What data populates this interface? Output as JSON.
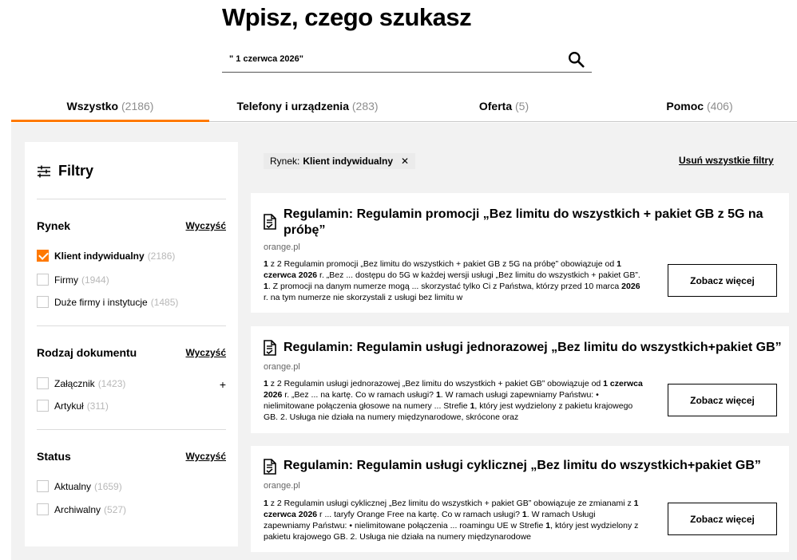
{
  "page": {
    "title": "Wpisz, czego szukasz"
  },
  "search": {
    "value": "\" 1 czerwca 2026\""
  },
  "tabs": [
    {
      "label": "Wszystko",
      "count": "(2186)"
    },
    {
      "label": "Telefony i urządzenia",
      "count": "(283)"
    },
    {
      "label": "Oferta",
      "count": "(5)"
    },
    {
      "label": "Pomoc",
      "count": "(406)"
    }
  ],
  "filters": {
    "title": "Filtry",
    "sections": [
      {
        "title": "Rynek",
        "clear_label": "Wyczyść",
        "options": [
          {
            "label": "Klient indywidualny",
            "count": "(2186)",
            "checked": true
          },
          {
            "label": "Firmy",
            "count": "(1944)",
            "checked": false
          },
          {
            "label": "Duże firmy i instytucje",
            "count": "(1485)",
            "checked": false
          }
        ]
      },
      {
        "title": "Rodzaj dokumentu",
        "clear_label": "Wyczyść",
        "expand_symbol": "+",
        "options": [
          {
            "label": "Załącznik",
            "count": "(1423)",
            "checked": false
          },
          {
            "label": "Artykuł",
            "count": "(311)",
            "checked": false
          }
        ]
      },
      {
        "title": "Status",
        "clear_label": "Wyczyść",
        "options": [
          {
            "label": "Aktualny",
            "count": "(1659)",
            "checked": false
          },
          {
            "label": "Archiwalny",
            "count": "(527)",
            "checked": false
          }
        ]
      }
    ]
  },
  "active_filter": {
    "prefix": "Rynek:",
    "value": "Klient indywidualny"
  },
  "remove_all_label": "Usuń wszystkie filtry",
  "results": [
    {
      "title_line1": "Regulamin: Regulamin promocji „Bez limitu do wszystkich + pakiet GB z 5G na",
      "title_line2": "próbę”",
      "source": "orange.pl",
      "snippet": [
        {
          "b": "1"
        },
        {
          "t": " z 2 Regulamin promocji „Bez limitu do wszystkich + pakiet GB z 5G na próbę” obowiązuje od "
        },
        {
          "b": "1 czerwca 2026"
        },
        {
          "t": " r. „Bez ... dostępu do 5G w każdej wersji usługi „Bez limitu do wszystkich + pakiet GB”. "
        },
        {
          "b": "1"
        },
        {
          "t": ". Z promocji na danym numerze mogą ... skorzystać tylko Ci z Państwa, którzy przed 10 marca "
        },
        {
          "b": "2026"
        },
        {
          "t": " r. na tym numerze nie skorzystali z usługi bez limitu w"
        }
      ],
      "button": "Zobacz więcej"
    },
    {
      "title_line1": "Regulamin: Regulamin usługi jednorazowej „Bez limitu do wszystkich+pakiet GB”",
      "title_line2": "",
      "source": "orange.pl",
      "snippet": [
        {
          "b": "1"
        },
        {
          "t": " z 2 Regulamin usługi jednorazowej „Bez limitu do wszystkich + pakiet GB” obowiązuje od "
        },
        {
          "b": "1 czerwca 2026"
        },
        {
          "t": " r. „Bez ... na kartę. Co w ramach usługi? "
        },
        {
          "b": "1"
        },
        {
          "t": ". W ramach usługi zapewniamy Państwu: • nielimitowane połączenia głosowe na numery ... Strefie "
        },
        {
          "b": "1"
        },
        {
          "t": ", który jest wydzielony z pakietu krajowego GB. 2. Usługa nie działa na numery międzynarodowe, skrócone oraz"
        }
      ],
      "button": "Zobacz więcej"
    },
    {
      "title_line1": "Regulamin: Regulamin usługi cyklicznej „Bez limitu do wszystkich+pakiet GB”",
      "title_line2": "",
      "source": "orange.pl",
      "snippet": [
        {
          "b": "1"
        },
        {
          "t": " z 2 Regulamin usługi cyklicznej „Bez limitu do wszystkich + pakiet GB” obowiązuje ze zmianami z "
        },
        {
          "b": "1 czerwca 2026"
        },
        {
          "t": " r ... taryfy Orange Free na kartę. Co w ramach usługi? "
        },
        {
          "b": "1"
        },
        {
          "t": ". W ramach Usługi zapewniamy Państwu: • nielimitowane połączenia ... roamingu UE w Strefie "
        },
        {
          "b": "1"
        },
        {
          "t": ", który jest wydzielony z pakietu krajowego GB. 2. Usługa nie działa na numery międzynarodowe"
        }
      ],
      "button": "Zobacz więcej"
    }
  ],
  "colors": {
    "accent": "#ff7900",
    "panel_bg": "#f2f2f2",
    "muted_count": "#8e8e8e"
  },
  "icons": {
    "search": "search-icon",
    "filters": "filter-sliders-icon",
    "document": "document-check-icon",
    "chip_close": "close-icon"
  }
}
